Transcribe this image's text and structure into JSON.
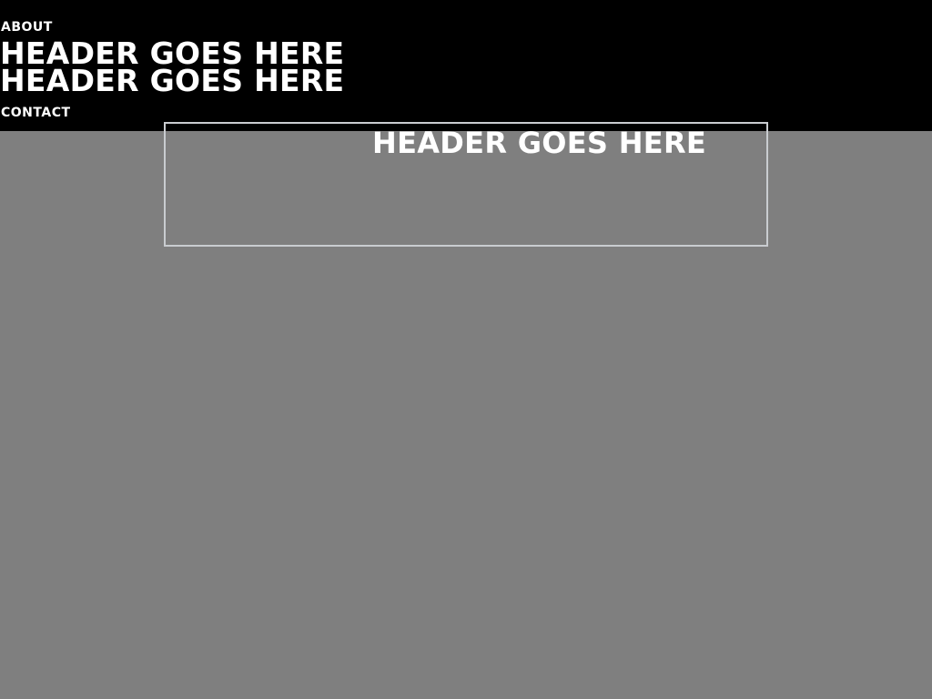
{
  "nav": {
    "about_label": "ABOUT",
    "contact_label": "CONTACT"
  },
  "header": {
    "line_1": "HEADER GOES HERE",
    "line_2": "HEADER GOES HERE"
  },
  "hero": {
    "title": "HEADER GOES HERE"
  },
  "colors": {
    "top_bar": "#000000",
    "background": "#7f7f7f",
    "text": "#ffffff",
    "box_border": "#c9ccd0"
  }
}
